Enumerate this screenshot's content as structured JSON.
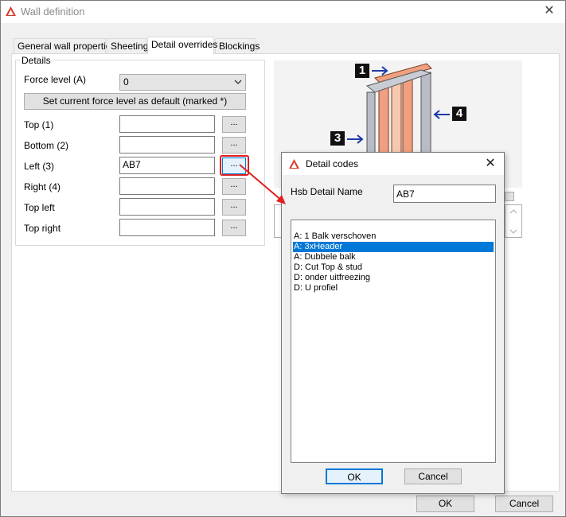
{
  "window": {
    "title": "Wall definition",
    "close_glyph": "✕"
  },
  "tabs": [
    {
      "label": "General wall properties"
    },
    {
      "label": "Sheeting"
    },
    {
      "label": "Detail overrides"
    },
    {
      "label": "Blockings"
    }
  ],
  "details": {
    "group_label": "Details",
    "force_level_label": "Force level (A)",
    "force_level_value": "0",
    "set_default_label": "Set current force level as default (marked *)",
    "rows": [
      {
        "label": "Top (1)",
        "value": ""
      },
      {
        "label": "Bottom (2)",
        "value": ""
      },
      {
        "label": "Left (3)",
        "value": "AB7"
      },
      {
        "label": "Right (4)",
        "value": ""
      },
      {
        "label": "Top left",
        "value": ""
      },
      {
        "label": "Top right",
        "value": ""
      }
    ],
    "browse_label": "..."
  },
  "illustration": {
    "marker_1": "1",
    "marker_2": "4",
    "marker_3": "3"
  },
  "footer": {
    "ok_label": "OK",
    "cancel_label": "Cancel"
  },
  "dialog": {
    "title": "Detail codes",
    "close_glyph": "✕",
    "name_label": "Hsb Detail Name",
    "name_value": "AB7",
    "items": [
      "A: 1 Balk verschoven",
      "A: 3xHeader",
      "A: Dubbele balk",
      "D: Cut Top & stud",
      "D: onder uitfreezing",
      "D: U profiel"
    ],
    "selected_index": 1,
    "ok_label": "OK",
    "cancel_label": "Cancel"
  },
  "colors": {
    "accent": "#0078d7",
    "highlight_red": "#e02020",
    "timber": "#f0a080"
  }
}
